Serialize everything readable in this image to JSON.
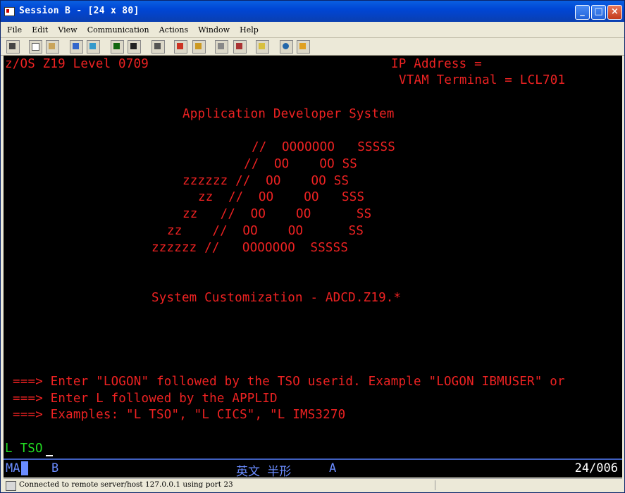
{
  "window": {
    "title": "Session B - [24 x 80]"
  },
  "menu": [
    "File",
    "Edit",
    "View",
    "Communication",
    "Actions",
    "Window",
    "Help"
  ],
  "toolbar": {
    "buttons": [
      "print-screen",
      "copy",
      "paste",
      "send",
      "receive",
      "display",
      "keypad",
      "macro-record",
      "macro-play",
      "macro-stop",
      "transfer-send",
      "transfer-receive",
      "clipboard",
      "web",
      "help"
    ]
  },
  "terminal": {
    "header_left": "z/OS Z19 Level 0709",
    "ip_label": "IP Address =",
    "vtam_label": "VTAM Terminal = LCL701",
    "system_name": "Application Developer System",
    "logo_lines": [
      "//  OOOOOOO   SSSSS",
      "//  OO    OO SS",
      "zzzzzz //  OO    OO SS",
      "zz  //  OO    OO   SSS",
      "zz   //  OO    OO      SS",
      "zz    //  OO    OO      SS",
      "zzzzzz //   OOOOOOO  SSSSS"
    ],
    "customization": "System Customization - ADCD.Z19.*",
    "instr1": "===> Enter \"LOGON\" followed by the TSO userid. Example \"LOGON IBMUSER\" or",
    "instr2": "===> Enter L followed by the APPLID",
    "instr3": "===> Examples: \"L TSO\", \"L CICS\", \"L IMS3270",
    "input": "L TSO"
  },
  "oia": {
    "ma": "MA",
    "session": "B",
    "ime": "英文 半形",
    "mode": "A",
    "cursor_pos": "24/006"
  },
  "status_bar": {
    "text": "Connected to remote server/host 127.0.0.1 using port 23"
  },
  "colors": {
    "terminal_text": "#ee2222",
    "input_text": "#22dd22",
    "oia_text": "#6a8cff",
    "title_bar": "#0046d5"
  }
}
